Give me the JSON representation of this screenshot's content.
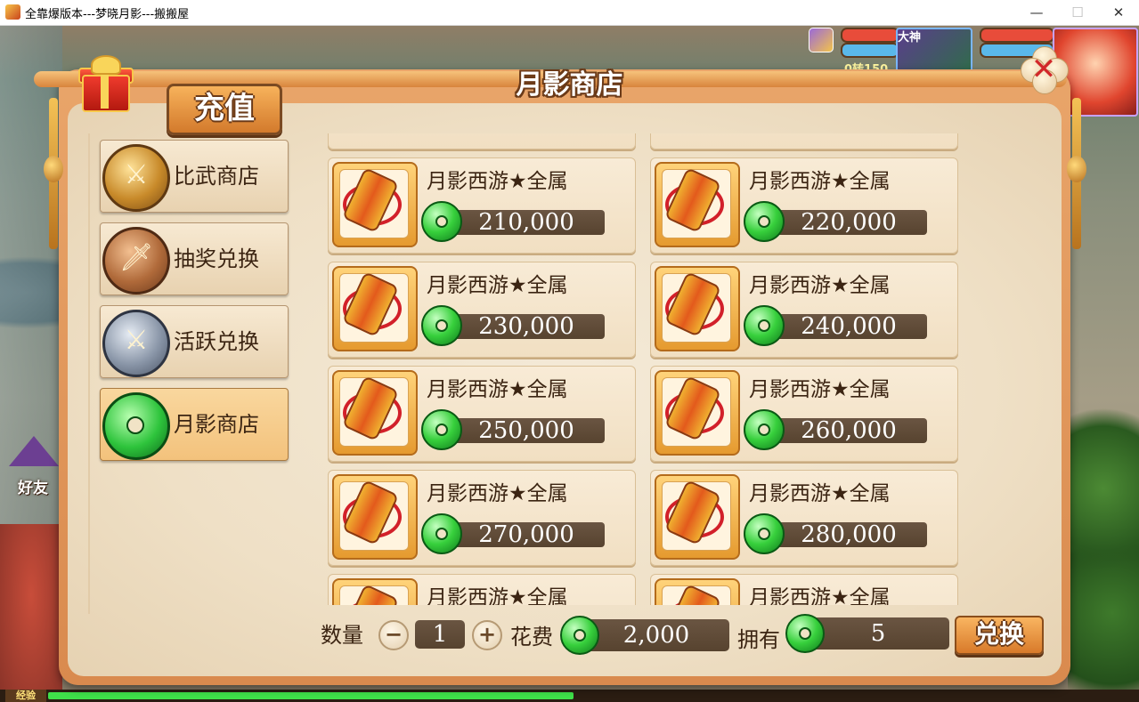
{
  "window": {
    "title": "全靠爆版本---梦晓月影---搬搬屋",
    "minimize": "—",
    "maximize": "☐",
    "close": "✕"
  },
  "hud": {
    "hero_tag": "大神",
    "partial_text": "0转150"
  },
  "shop": {
    "title": "月影商店",
    "recharge_label": "充值",
    "close_symbol": "✕",
    "friend_label": "好友",
    "exp_label": "经验",
    "exp_progress": 0.5,
    "accent_color": "#e59a2f",
    "currency_color": "#2ec43c"
  },
  "sidebar": {
    "items": [
      {
        "label": "比武商店",
        "icon": "crossed-swords-icon",
        "active": false
      },
      {
        "label": "抽奖兑换",
        "icon": "sword-emblem-icon",
        "active": false
      },
      {
        "label": "活跃兑换",
        "icon": "silver-sword-icon",
        "active": false
      },
      {
        "label": "月影商店",
        "icon": "jade-coin-icon",
        "active": true
      }
    ]
  },
  "items": [
    {
      "name": "月影西游★全属",
      "price": "210,000"
    },
    {
      "name": "月影西游★全属",
      "price": "220,000"
    },
    {
      "name": "月影西游★全属",
      "price": "230,000"
    },
    {
      "name": "月影西游★全属",
      "price": "240,000"
    },
    {
      "name": "月影西游★全属",
      "price": "250,000"
    },
    {
      "name": "月影西游★全属",
      "price": "260,000"
    },
    {
      "name": "月影西游★全属",
      "price": "270,000"
    },
    {
      "name": "月影西游★全属",
      "price": "280,000"
    },
    {
      "name": "月影西游★全属",
      "price": ""
    },
    {
      "name": "月影西游★全属",
      "price": ""
    }
  ],
  "purchase": {
    "quantity_label": "数量",
    "quantity": "1",
    "minus": "−",
    "plus": "+",
    "cost_label": "花费",
    "cost": "2,000",
    "owned_label": "拥有",
    "owned": "5",
    "exchange_label": "兑换"
  }
}
